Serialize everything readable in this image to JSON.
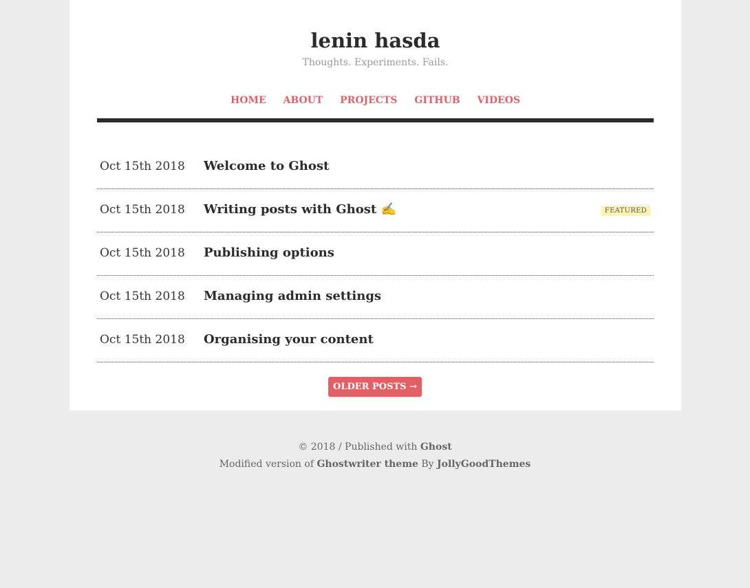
{
  "site": {
    "title": "lenin hasda",
    "tagline": "Thoughts. Experiments. Fails."
  },
  "nav": {
    "items": [
      {
        "label": "HOME"
      },
      {
        "label": "ABOUT"
      },
      {
        "label": "PROJECTS"
      },
      {
        "label": "GITHUB"
      },
      {
        "label": "VIDEOS"
      }
    ]
  },
  "posts": [
    {
      "date": "Oct 15th 2018",
      "title": "Welcome to Ghost",
      "badge": ""
    },
    {
      "date": "Oct 15th 2018",
      "title": "Writing posts with Ghost ✍️",
      "badge": "FEATURED"
    },
    {
      "date": "Oct 15th 2018",
      "title": "Publishing options",
      "badge": ""
    },
    {
      "date": "Oct 15th 2018",
      "title": "Managing admin settings",
      "badge": ""
    },
    {
      "date": "Oct 15th 2018",
      "title": "Organising your content",
      "badge": ""
    }
  ],
  "pagination": {
    "older_label": "OLDER POSTS →"
  },
  "footer": {
    "copyright": "© 2018 / Published with",
    "ghost_link": "Ghost",
    "modified_prefix": "Modified version of",
    "theme_link": "Ghostwriter theme",
    "by": "By",
    "author_link": "JollyGoodThemes"
  },
  "colors": {
    "accent": "#e25f66",
    "background": "#ececec",
    "card": "#ffffff",
    "badge_bg": "#fff3b0"
  }
}
